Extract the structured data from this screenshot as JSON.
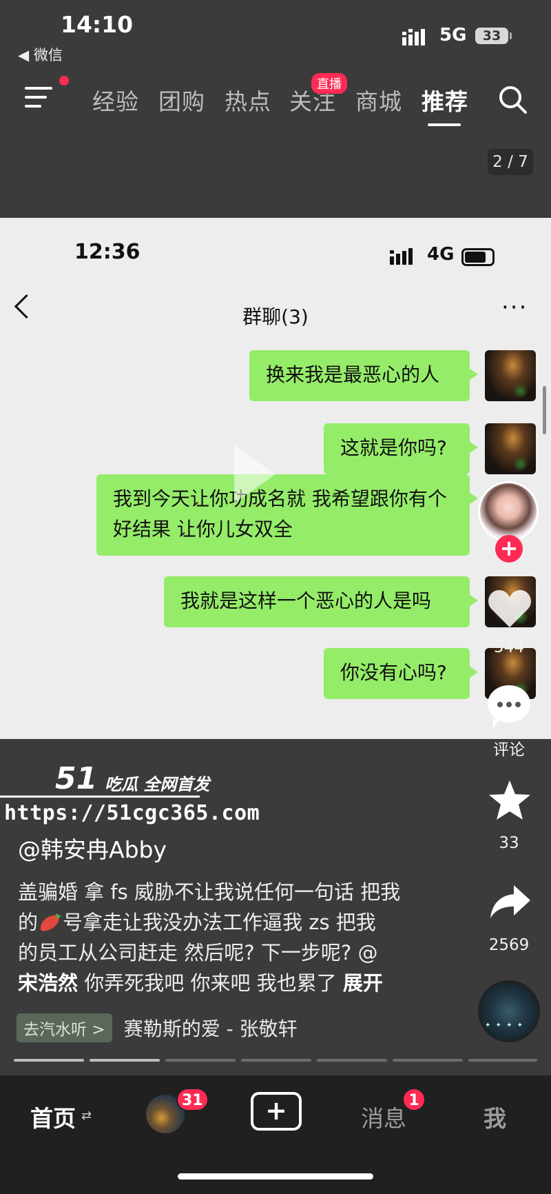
{
  "outer_status": {
    "time": "14:10",
    "back_app": "◀ 微信",
    "network": "5G",
    "battery": "33"
  },
  "top_nav": {
    "tabs": [
      "经验",
      "团购",
      "热点",
      "关注",
      "商城",
      "推荐"
    ],
    "active_tab": "推荐",
    "live_badge": "直播",
    "page_counter": "2 / 7"
  },
  "chat_screenshot": {
    "time": "12:36",
    "network": "4G",
    "title": "群聊(3)",
    "more": "···",
    "messages": [
      "换来我是最恶心的人",
      "这就是你吗?",
      "我到今天让你功成名就 我希望跟你有个好结果 让你儿女双全",
      "我就是这样一个恶心的人是吗",
      "你没有心吗?"
    ]
  },
  "side_actions": {
    "like_count": "544",
    "comment_label": "评论",
    "favorite_count": "33",
    "share_count": "2569"
  },
  "watermark": {
    "logo": "51",
    "tagline": "吃瓜 全网首发",
    "url": "https://51cgc365.com"
  },
  "caption": {
    "author": "@韩安冉Abby",
    "line1": "盖骗婚 拿 fs 威胁不让我说任何一句话 把我",
    "line2a": "的",
    "line2b": "号拿走让我没办法工作逼我 zs  把我",
    "line3": "的员工从公司赶走 然后呢? 下一步呢? @",
    "mention": "宋浩然",
    "line4": " 你弄死我吧 你来吧 我也累了 ",
    "expand": "展开"
  },
  "music": {
    "tag": "去汽水听 >",
    "title": "赛勒斯的爱 - 张敬轩"
  },
  "progress": {
    "total_segments": 7,
    "current_segment": 2
  },
  "bottom_bar": {
    "home": "首页",
    "home_arrows": "⇄",
    "friend_badge": "31",
    "add": "+",
    "messages": "消息",
    "messages_badge": "1",
    "me": "我"
  },
  "colors": {
    "accent": "#ff2b55",
    "bubble": "#95ec69",
    "chat_bg": "#ededed"
  }
}
